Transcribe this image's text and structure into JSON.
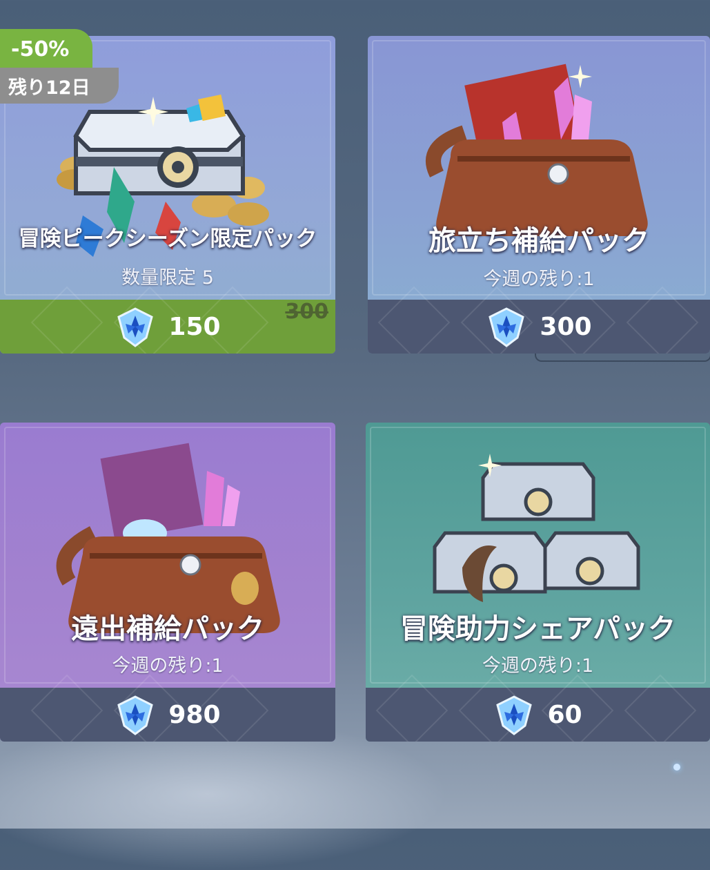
{
  "shop": {
    "items": [
      {
        "name": "冒険ピークシーズン限定パック",
        "sub": "数量限定 5",
        "price": "150",
        "old_price": "300",
        "discount": "-50%",
        "remaining": "残り12日",
        "icon": "chest-with-gems-icon"
      },
      {
        "name": "旅立ち補給パック",
        "sub": "今週の残り:1",
        "price": "300",
        "icon": "leather-bag-with-crystals-icon"
      },
      {
        "name": "遠出補給パック",
        "sub": "今週の残り:1",
        "price": "980",
        "icon": "leather-bag-with-book-icon"
      },
      {
        "name": "冒険助力シェアパック",
        "sub": "今週の残り:1",
        "price": "60",
        "icon": "stacked-chests-icon"
      }
    ],
    "currency_icon": "primogem-icon",
    "colors": {
      "sale_green": "#6f9f3a",
      "badge_green": "#79b441",
      "price_bar": "#4d5772"
    }
  }
}
